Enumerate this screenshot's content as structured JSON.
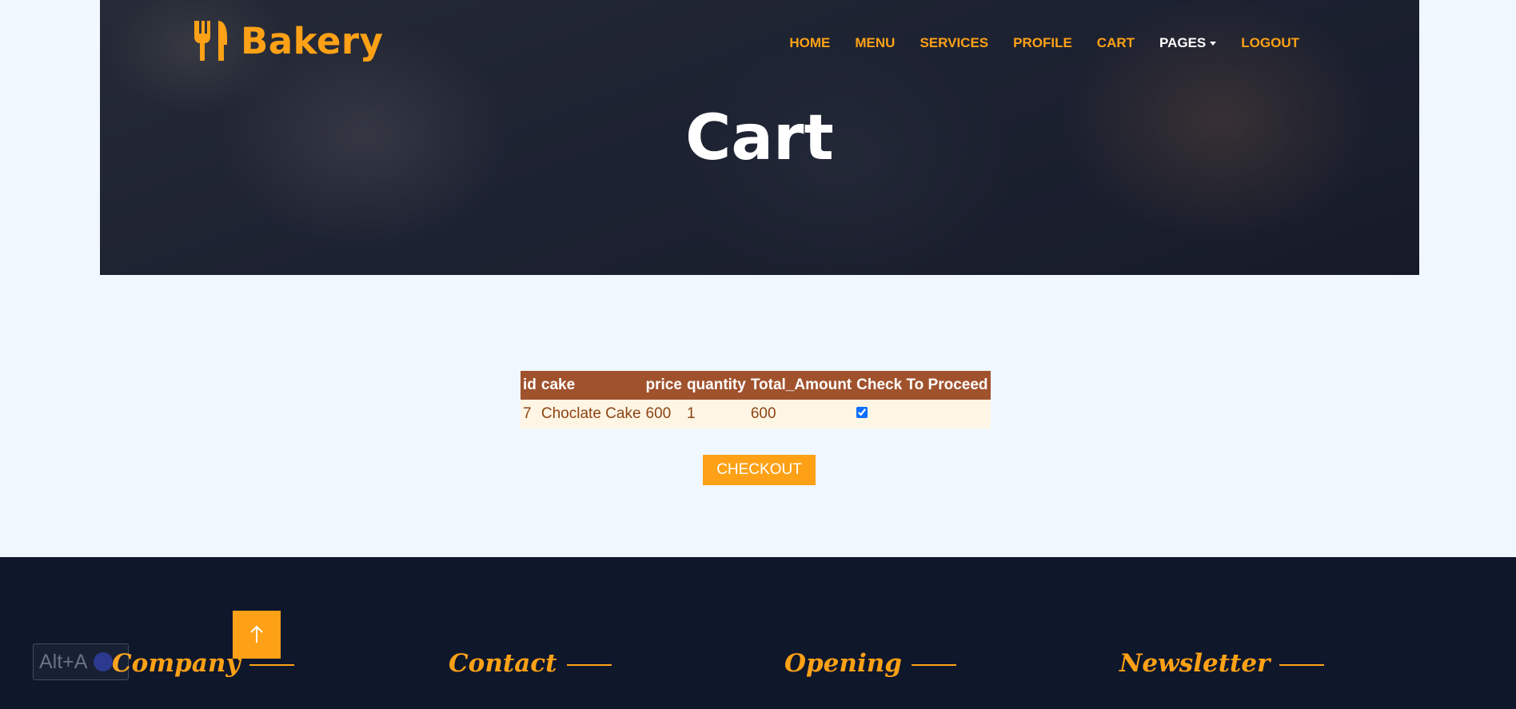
{
  "brand": {
    "name": "Bakery",
    "icon": "utensils-icon"
  },
  "nav": {
    "items": [
      {
        "label": "HOME",
        "active": false
      },
      {
        "label": "MENU",
        "active": false
      },
      {
        "label": "SERVICES",
        "active": false
      },
      {
        "label": "PROFILE",
        "active": false
      },
      {
        "label": "CART",
        "active": false
      },
      {
        "label": "PAGES",
        "active": true,
        "dropdown": true
      },
      {
        "label": "LOGOUT",
        "active": false
      }
    ]
  },
  "hero": {
    "title": "Cart"
  },
  "cart": {
    "headers": [
      "id",
      "cake",
      "price",
      "quantity",
      "Total_Amount",
      "Check To Proceed"
    ],
    "rows": [
      {
        "id": "7",
        "cake": "Choclate Cake",
        "price": "600",
        "quantity": "1",
        "total": "600",
        "checked": true
      }
    ],
    "checkout_label": "CHECKOUT"
  },
  "footer": {
    "columns": [
      "Company",
      "Contact",
      "Opening",
      "Newsletter"
    ]
  },
  "overlay": {
    "shortcut_label": "Alt+A",
    "back_to_top_icon": "arrow-up-icon"
  },
  "colors": {
    "accent": "#fea116",
    "header_bg": "#a0522d",
    "footer_bg": "#0f172b",
    "page_bg": "#f0f7ff"
  }
}
